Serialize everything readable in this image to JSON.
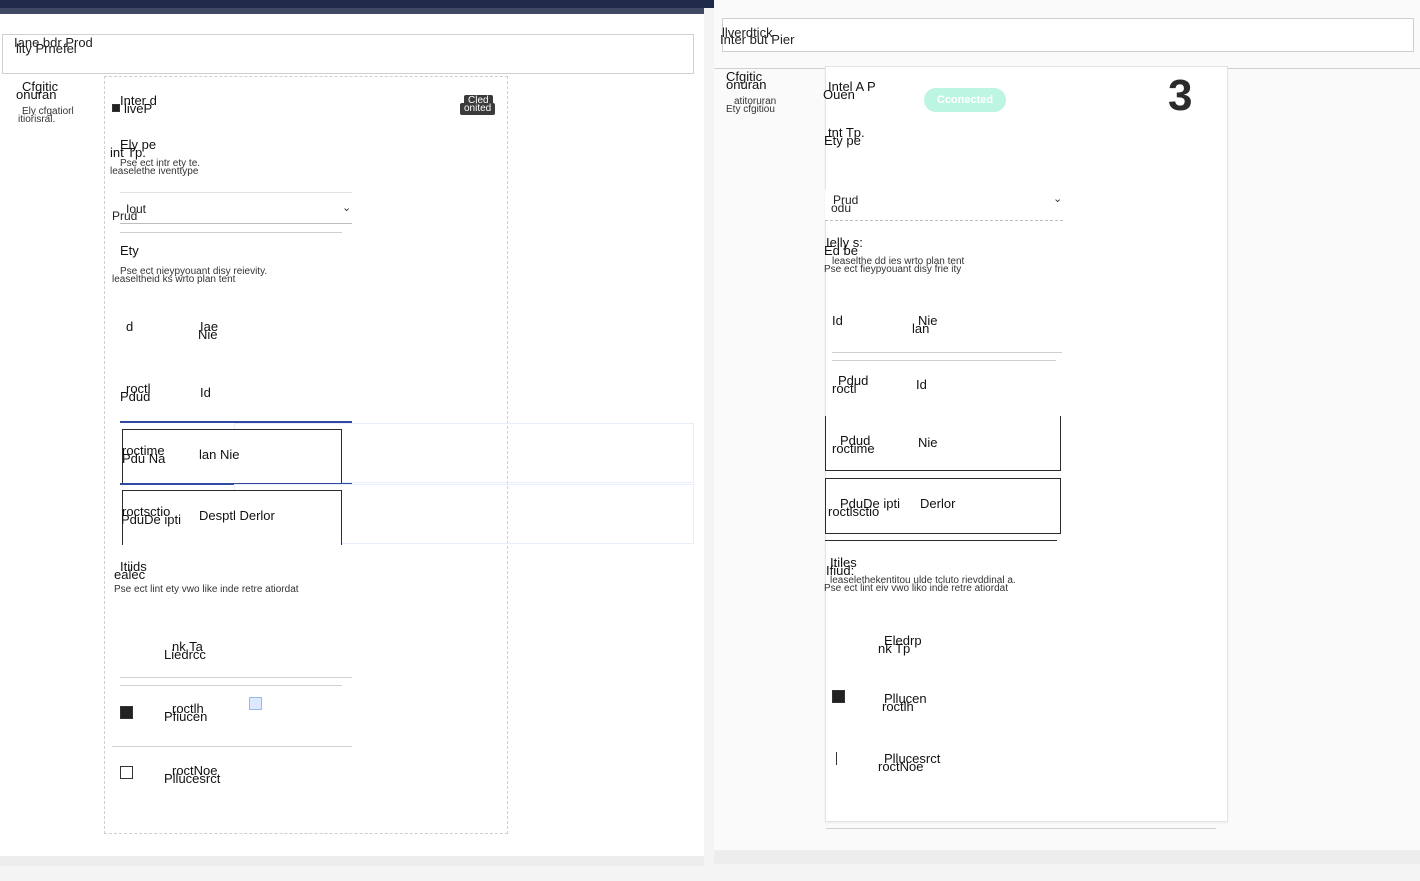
{
  "left": {
    "header": {
      "line1": "Iane bdr Prod",
      "line2": "lity Prnefel"
    },
    "sidebar": {
      "title_a": "Cfgitic",
      "title_b": "onuran",
      "sub_a": "Ely cfgatiorl",
      "sub_b": "itiorisral."
    },
    "card": {
      "title_a": "Inter d",
      "title_b": "liveP",
      "badge_a": "Cled",
      "badge_b": "onited",
      "section1": {
        "label_a": "Ely pe",
        "label_b": "int Tp.",
        "desc_a": "Pse ect  intr ety te.",
        "desc_b": "leaselethe iventtype"
      },
      "select": {
        "value_a": "Iout",
        "value_b": "Prud"
      },
      "section2": {
        "label_a": "Ety",
        "label_b": "",
        "desc_a": "Pse ect  nieypyouant disy reievity.",
        "desc_b": "leaseltheid ks   wrto plan tent"
      },
      "rows": [
        {
          "a": "d",
          "b": "Iae",
          "c": "Nie"
        },
        {
          "a": "roctl",
          "b": "Pdud",
          "c": "Id"
        },
        {
          "a": "roctime",
          "b": "Pdu Na",
          "c": "lan Nie"
        },
        {
          "a": "roctsctio",
          "b": "PduDe ipti",
          "c": "Desptl Derlor"
        }
      ],
      "section3": {
        "label_a": "Itiids",
        "label_b": "ealec",
        "desc": "Pse ect  lint ety vwo like inde retre atiordat"
      },
      "list_header": {
        "a": "nk Ta",
        "b": "Liedrcc"
      },
      "list": [
        {
          "a": "roctlh",
          "b": "Pfiucen",
          "checked": true
        },
        {
          "a": "roctNoe",
          "b": "Pllucesrct",
          "checked": false
        }
      ]
    }
  },
  "right": {
    "header": {
      "line1": "llverdtick",
      "line2": "Inter but Pier"
    },
    "sidebar": {
      "title_a": "Cfgitic",
      "title_b": "onuran",
      "sub_a": "atitoruran",
      "sub_b": "Ety cfgitiou"
    },
    "card": {
      "title_a": "Intel A P",
      "title_b": "Ouen",
      "pill": "Cconected",
      "big_number": "3",
      "section1": {
        "label_a": "tnt Tp.",
        "label_b": "Ety pe"
      },
      "select": {
        "value_a": "Prud",
        "value_b": "odu"
      },
      "section2": {
        "label_a": "Ielly s:",
        "label_b": "Ed be",
        "desc_a": "leaselthe dd ies  wrto plan tent",
        "desc_b": "Pse ect  fieypyouant disy frie ity"
      },
      "rows": [
        {
          "a": "Id",
          "b": "Nie",
          "c": "lan"
        },
        {
          "a": "Pdud",
          "b": "roctl",
          "c": "Id"
        },
        {
          "a": "Pdud",
          "b": "roctime",
          "c": "Nie"
        },
        {
          "a": "PduDe ipti",
          "b": "roctlsctio",
          "c": "Derlor"
        }
      ],
      "section3": {
        "label_a": "Itiles",
        "label_b": "Ifiud:",
        "desc_a": "leaselethekentitou ulde tcluto rievddinal a.",
        "desc_b": "Pse ect  lint eiv vwo liko inde retre atiordat"
      },
      "list_header": {
        "a": "Eledrp",
        "b": "nk Tp"
      },
      "list": [
        {
          "a": "Pllucen",
          "b": "roctlh",
          "checked": true
        },
        {
          "a": "Pllucesrct",
          "b": "roctNoe",
          "checked": false
        }
      ]
    }
  }
}
